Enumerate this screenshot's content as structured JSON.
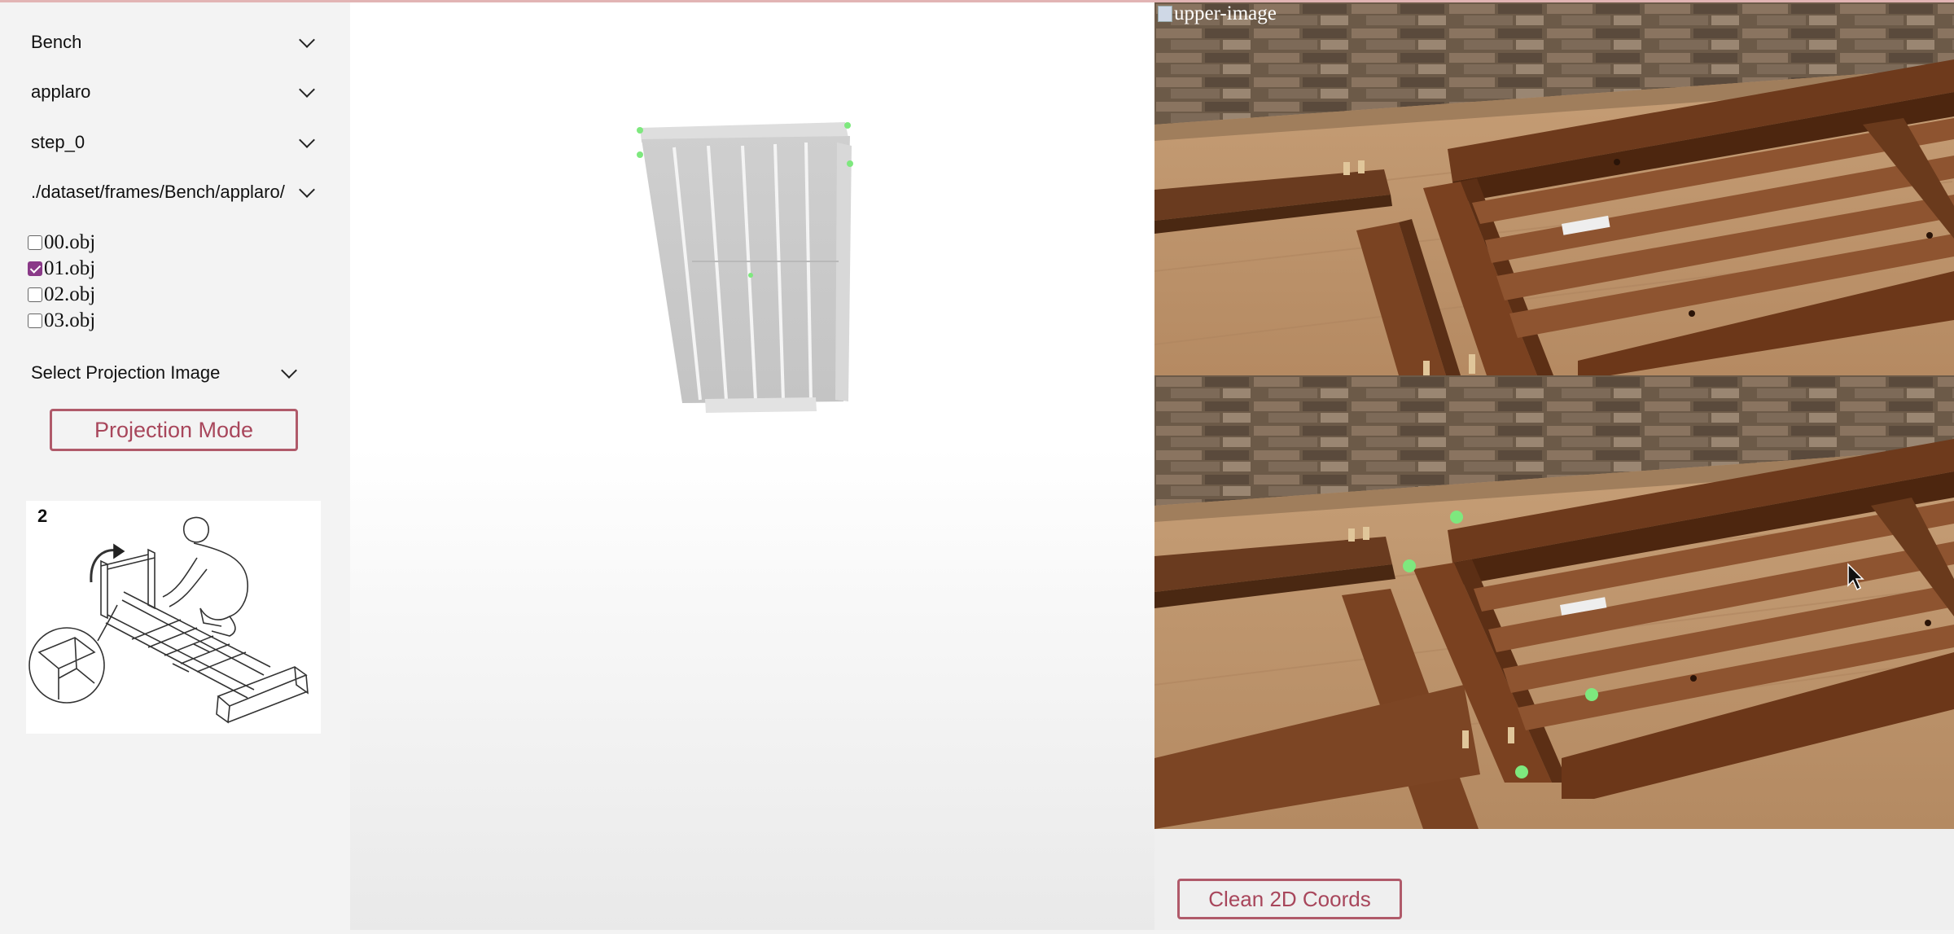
{
  "sidebar": {
    "category": "Bench",
    "furniture": "applaro",
    "step": "step_0",
    "frame_path": "./dataset/frames/Bench/applaro/",
    "objects": [
      {
        "label": "00.obj",
        "checked": false
      },
      {
        "label": "01.obj",
        "checked": true
      },
      {
        "label": "02.obj",
        "checked": false
      },
      {
        "label": "03.obj",
        "checked": false
      }
    ],
    "projection_select": "Select Projection Image",
    "projection_button": "Projection Mode",
    "manual_step_number": "2"
  },
  "right": {
    "upper_image_alt": "upper-image",
    "clean_button": "Clean 2D Coords"
  },
  "colors": {
    "accent": "#a8465b",
    "checkbox": "#8a3a88",
    "keypoint": "#7ee87e",
    "model": "#cdcdcd"
  }
}
